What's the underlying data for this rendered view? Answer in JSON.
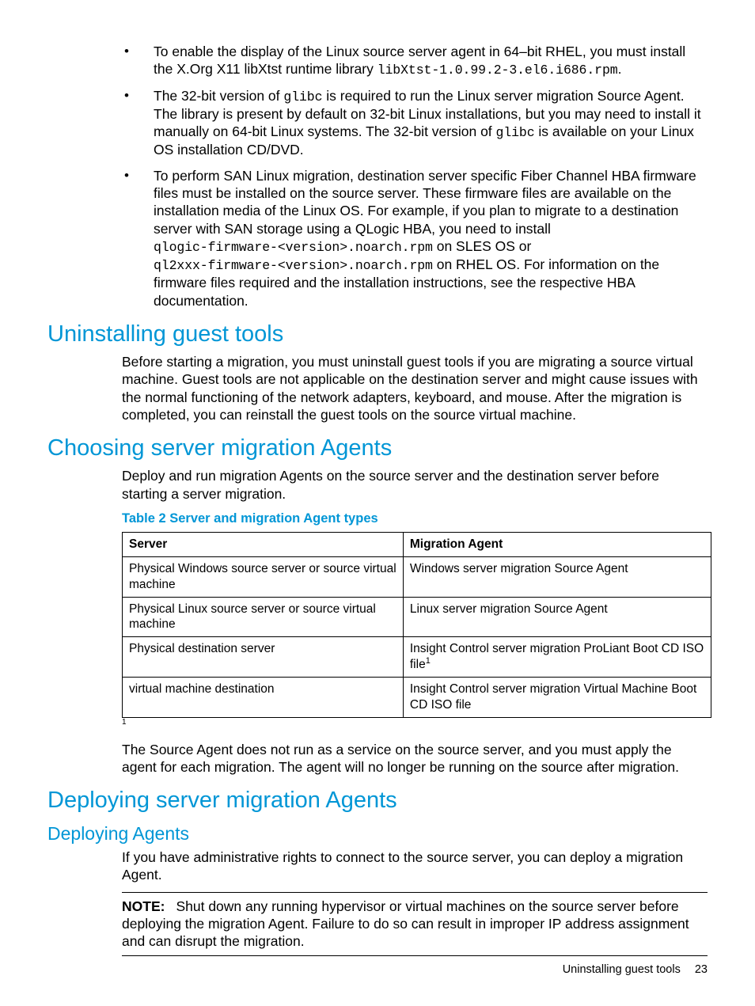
{
  "bullets": {
    "b1a": "To enable the display of the Linux source server agent in 64–bit RHEL, you must install the X.Org X11 libXtst runtime library ",
    "b1code": "libXtst-1.0.99.2-3.el6.i686.rpm",
    "b1b": ".",
    "b2a": "The 32-bit version of ",
    "b2code1": "glibc",
    "b2b": " is required to run the Linux server migration Source Agent. The library is present by default on 32-bit Linux installations, but you may need to install it manually on 64-bit Linux systems. The 32-bit version of ",
    "b2code2": "glibc",
    "b2c": " is available on your Linux OS installation CD/DVD.",
    "b3a": "To perform SAN Linux migration, destination server specific Fiber Channel HBA firmware files must be installed on the source server. These firmware files are available on the installation media of the Linux OS. For example, if you plan to migrate to a destination server with SAN storage using a QLogic HBA, you need to install ",
    "b3code1": "qlogic-firmware-<version>.noarch.rpm",
    "b3b": " on SLES OS or ",
    "b3code2": "ql2xxx-firmware-<version>.noarch.rpm",
    "b3c": " on RHEL OS. For information on the firmware files required and the installation instructions, see the respective HBA documentation."
  },
  "sections": {
    "uninstall_title": "Uninstalling guest tools",
    "uninstall_body": "Before starting a migration, you must uninstall guest tools if you are migrating a source virtual machine. Guest tools are not applicable on the destination server and might cause issues with the normal functioning of the network adapters, keyboard, and mouse. After the migration is completed, you can reinstall the guest tools on the source virtual machine.",
    "choosing_title": "Choosing server migration Agents",
    "choosing_body": "Deploy and run migration Agents on the source server and the destination server before starting a server migration.",
    "table_caption": "Table 2 Server and migration Agent types",
    "table_head_server": "Server",
    "table_head_agent": "Migration Agent",
    "r1c1": "Physical Windows source server or source virtual machine",
    "r1c2": "Windows server migration Source Agent",
    "r2c1": "Physical Linux source server or source virtual machine",
    "r2c2": "Linux server migration Source Agent",
    "r3c1": "Physical destination server",
    "r3c2": "Insight Control server migration ProLiant Boot CD ISO file",
    "r3sup": "1",
    "r4c1": "virtual machine destination",
    "r4c2": "Insight Control server migration Virtual Machine Boot CD ISO file",
    "footnote1": "1",
    "choosing_after": "The Source Agent does not run as a service on the source server, and you must apply the agent for each migration. The agent will no longer be running on the source after migration.",
    "deploying_title": "Deploying server migration Agents",
    "deploying_agents_title": "Deploying Agents",
    "deploying_body": "If you have administrative rights to connect to the source server, you can deploy a migration Agent.",
    "note_label": "NOTE:",
    "note_body": "Shut down any running hypervisor or virtual machines on the source server before deploying the migration Agent. Failure to do so can result in improper IP address assignment and can disrupt the migration."
  },
  "footer": {
    "text": "Uninstalling guest tools",
    "page": "23"
  }
}
